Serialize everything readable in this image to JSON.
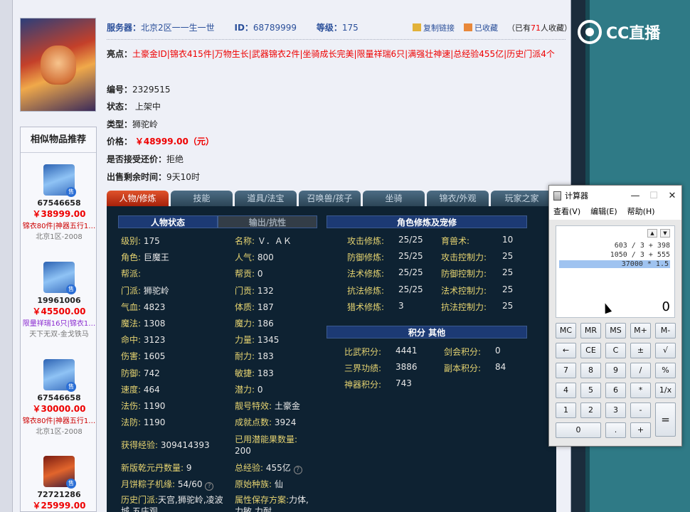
{
  "item": {
    "server_label": "服务器：",
    "server": "北京2区一一生一世",
    "id_label": "ID：",
    "id": "68789999",
    "level_label": "等级：",
    "level": "175",
    "copy_link": "复制链接",
    "favorited": "已收藏",
    "fav_count_prefix": "（已有",
    "fav_count": "71",
    "fav_count_suffix": "人收藏）",
    "highlights_label": "亮点：",
    "highlights": "土豪金ID|锦衣415件|万物生长|武器锦衣2件|坐骑成长完美|限量祥瑞6只|满强壮神速|总经验455亿|历史门派4个",
    "serial_label": "编号：",
    "serial": "2329515",
    "status_label": "状态：",
    "status": "上架中",
    "type_label": "类型：",
    "type": "狮驼岭",
    "price_label": "价格：",
    "price": "￥48999.00（元）",
    "bargain_label": "是否接受还价：",
    "bargain": "拒绝",
    "time_left_label": "出售剩余时间：",
    "time_left": "9天10时"
  },
  "similar": {
    "title": "相似物品推荐",
    "items": [
      {
        "id": "67546658",
        "price": "￥38999.00",
        "tags": "锦衣80件|神器五行1…",
        "server": "北京1区-2008"
      },
      {
        "id": "19961006",
        "price": "￥45500.00",
        "tags": "限量祥瑞16只|锦衣1…",
        "server": "天下无双-金戈铁马"
      },
      {
        "id": "67546658",
        "price": "￥30000.00",
        "tags": "锦衣80件|神器五行1…",
        "server": "北京1区-2008"
      },
      {
        "id": "72721286",
        "price": "￥25999.00"
      }
    ],
    "sell_badge": "售"
  },
  "tabs": [
    "人物/修炼",
    "技能",
    "道具/法宝",
    "召唤兽/孩子",
    "坐骑",
    "锦衣/外观",
    "玩家之家"
  ],
  "panel": {
    "char_status": "人物状态",
    "output_resist": "输出/抗性",
    "cultivation": "角色修炼及宠修",
    "points": "积分 其他",
    "stats_left": [
      {
        "k": "级别:",
        "v": "175"
      },
      {
        "k": "角色:",
        "v": "巨魔王"
      },
      {
        "k": "帮派:",
        "v": ""
      },
      {
        "k": "门派:",
        "v": "狮驼岭"
      },
      {
        "k": "气血:",
        "v": "4823"
      },
      {
        "k": "魔法:",
        "v": "1308"
      },
      {
        "k": "命中:",
        "v": "3123"
      },
      {
        "k": "伤害:",
        "v": "1605"
      },
      {
        "k": "防御:",
        "v": "742"
      },
      {
        "k": "速度:",
        "v": "464"
      },
      {
        "k": "法伤:",
        "v": "1190"
      },
      {
        "k": "法防:",
        "v": "1190"
      }
    ],
    "stats_right": [
      {
        "k": "名称:",
        "v": "Ｖ．ＡＫ"
      },
      {
        "k": "人气:",
        "v": "800"
      },
      {
        "k": "帮贡:",
        "v": "0"
      },
      {
        "k": "门贡:",
        "v": "132"
      },
      {
        "k": "体质:",
        "v": "187"
      },
      {
        "k": "魔力:",
        "v": "186"
      },
      {
        "k": "力量:",
        "v": "1345"
      },
      {
        "k": "耐力:",
        "v": "183"
      },
      {
        "k": "敏捷:",
        "v": "183"
      },
      {
        "k": "潜力:",
        "v": "0"
      },
      {
        "k": "靓号特效:",
        "v": "土豪金"
      },
      {
        "k": "成就点数:",
        "v": "3924"
      }
    ],
    "exp_label": "获得经验:",
    "exp": "309414393",
    "used_potential_label": "已用潜能果数量:",
    "used_potential": "200",
    "qianyuan_label": "新版乾元丹数量:",
    "qianyuan": "9",
    "total_exp_label": "总经验:",
    "total_exp": "455亿",
    "mooncake_label": "月饼粽子机缘:",
    "mooncake": "54/60",
    "race_label": "原始种族:",
    "race": "仙",
    "history_label": "历史门派:",
    "history": "天宫,狮驼岭,凌波城,五庄观",
    "attr_save_label": "属性保存方案:",
    "attr_save": "力体,力敏,力耐",
    "cult_left": [
      {
        "k": "攻击修炼:",
        "v": "25/25"
      },
      {
        "k": "防御修炼:",
        "v": "25/25"
      },
      {
        "k": "法术修炼:",
        "v": "25/25"
      },
      {
        "k": "抗法修炼:",
        "v": "25/25"
      },
      {
        "k": "猎术修炼:",
        "v": "3"
      }
    ],
    "cult_right": [
      {
        "k": "育兽术:",
        "v": "10"
      },
      {
        "k": "攻击控制力:",
        "v": "25"
      },
      {
        "k": "防御控制力:",
        "v": "25"
      },
      {
        "k": "法术控制力:",
        "v": "25"
      },
      {
        "k": "抗法控制力:",
        "v": "25"
      }
    ],
    "points_left": [
      {
        "k": "比武积分:",
        "v": "4441"
      },
      {
        "k": "三界功绩:",
        "v": "3886"
      },
      {
        "k": "神器积分:",
        "v": "743"
      }
    ],
    "points_right": [
      {
        "k": "剑会积分:",
        "v": "0"
      },
      {
        "k": "副本积分:",
        "v": "84"
      }
    ]
  },
  "calculator": {
    "title": "计算器",
    "menu": [
      "查看(V)",
      "编辑(E)",
      "帮助(H)"
    ],
    "history": [
      "603 / 3 + 398",
      "1050 / 3 + 555",
      "37000 * 1.5"
    ],
    "result": "0",
    "buttons": {
      "mc": "MC",
      "mr": "MR",
      "ms": "MS",
      "mplus": "M+",
      "mminus": "M-",
      "back": "←",
      "ce": "CE",
      "c": "C",
      "pm": "±",
      "sqrt": "√",
      "n7": "7",
      "n8": "8",
      "n9": "9",
      "div": "/",
      "pct": "%",
      "n4": "4",
      "n5": "5",
      "n6": "6",
      "mul": "*",
      "inv": "1/x",
      "n1": "1",
      "n2": "2",
      "n3": "3",
      "sub": "-",
      "eq": "=",
      "n0": "0",
      "dot": ".",
      "add": "+"
    }
  },
  "branding": {
    "cc_text": "CC直播"
  }
}
